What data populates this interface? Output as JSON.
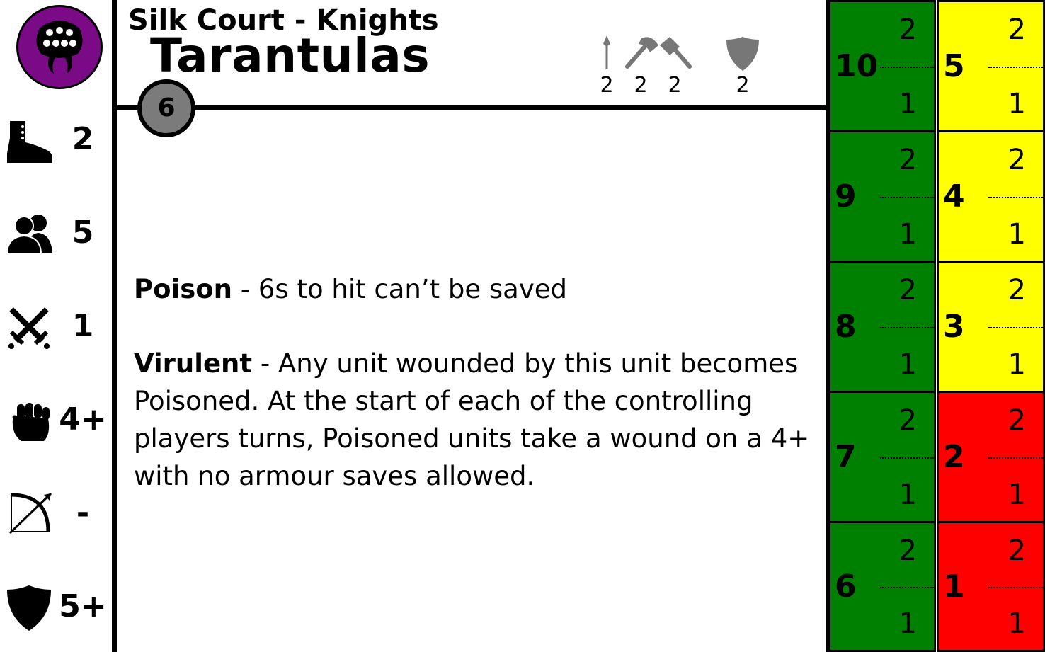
{
  "header": {
    "faction": "Silk Court - Knights",
    "unit_name": "Tarantulas",
    "points": "6",
    "weapons": [
      {
        "icon": "spear-icon",
        "value": "2"
      },
      {
        "icon": "axe-icon",
        "value": "2"
      },
      {
        "icon": "hammer-icon",
        "value": "2"
      },
      {
        "icon": "shield-icon",
        "value": "2"
      }
    ]
  },
  "faction_icon": "spider-face-icon",
  "colors": {
    "faction": "#7a0a86",
    "green": "#008000",
    "yellow": "#ffff00",
    "red": "#ff0000",
    "points_badge": "#7b7b7b",
    "weapon_icon": "#777777"
  },
  "stats": [
    {
      "icon": "boot-icon",
      "value": "2"
    },
    {
      "icon": "group-icon",
      "value": "5"
    },
    {
      "icon": "crossed-swords-icon",
      "value": "1"
    },
    {
      "icon": "fist-icon",
      "value": "4+"
    },
    {
      "icon": "bow-icon",
      "value": "-"
    },
    {
      "icon": "shield-icon",
      "value": "5+"
    }
  ],
  "rules": [
    {
      "name": "Poison",
      "text": " - 6s to hit can’t be saved"
    },
    {
      "name": "Virulent",
      "text": " - Any unit wounded by this unit becomes Poisoned. At the start of each of the controlling players turns, Poisoned units take a wound on a 4+ with no armour saves allowed."
    }
  ],
  "wound_track": {
    "left": [
      {
        "wounds": "10",
        "top": "2",
        "bottom": "1",
        "color": "green"
      },
      {
        "wounds": "9",
        "top": "2",
        "bottom": "1",
        "color": "green"
      },
      {
        "wounds": "8",
        "top": "2",
        "bottom": "1",
        "color": "green"
      },
      {
        "wounds": "7",
        "top": "2",
        "bottom": "1",
        "color": "green"
      },
      {
        "wounds": "6",
        "top": "2",
        "bottom": "1",
        "color": "green"
      }
    ],
    "right": [
      {
        "wounds": "5",
        "top": "2",
        "bottom": "1",
        "color": "yellow"
      },
      {
        "wounds": "4",
        "top": "2",
        "bottom": "1",
        "color": "yellow"
      },
      {
        "wounds": "3",
        "top": "2",
        "bottom": "1",
        "color": "yellow"
      },
      {
        "wounds": "2",
        "top": "2",
        "bottom": "1",
        "color": "red"
      },
      {
        "wounds": "1",
        "top": "2",
        "bottom": "1",
        "color": "red"
      }
    ]
  }
}
